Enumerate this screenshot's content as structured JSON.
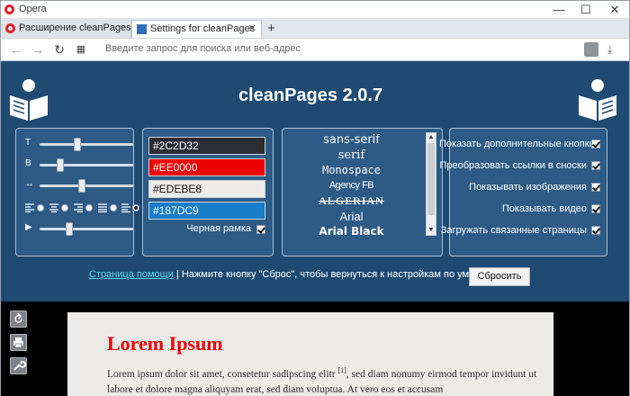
{
  "browser": {
    "app_name": "Opera",
    "tabs": [
      {
        "label": "Расширение cleanPages"
      },
      {
        "label": "Settings for cleanPages"
      }
    ],
    "address_placeholder": "Введите запрос для поиска или веб-адрес"
  },
  "settings": {
    "title": "cleanPages 2.0.7",
    "sliders": [
      {
        "name": "font-size",
        "level": 0.4
      },
      {
        "name": "line-height",
        "level": 0.2
      },
      {
        "name": "margins",
        "level": 0.45
      },
      {
        "name": "speed",
        "level": 0.3
      }
    ],
    "alignment_selected": 4,
    "colors": [
      {
        "value": "#2C2D32",
        "bg": "#2C2D32",
        "fg": "#ffffff"
      },
      {
        "value": "#EE0000",
        "bg": "#EE0000",
        "fg": "#ffffff"
      },
      {
        "value": "#EDEBE8",
        "bg": "#EDEBE8",
        "fg": "#111111"
      },
      {
        "value": "#187DC9",
        "bg": "#187DC9",
        "fg": "#ffffff"
      }
    ],
    "black_frame_label": "Черная рамка",
    "fonts": [
      "sans-serif",
      "serif",
      "Monospace",
      "Agency FB",
      "ALGERIAN",
      "Arial",
      "Arial Black"
    ],
    "options": [
      {
        "label": "Показать дополнительные кнопки",
        "checked": true
      },
      {
        "label": "Преобразовать ссылки в сноски",
        "checked": true
      },
      {
        "label": "Показывать изображения",
        "checked": true
      },
      {
        "label": "Показывать видео",
        "checked": true
      },
      {
        "label": "Загружать связанные страницы",
        "checked": true
      }
    ],
    "help_link": "Страница помощи",
    "help_text": " | Нажмите кнопку \"Сброс\", чтобы вернуться к настройкам по умолчанию.",
    "reset_label": "Сбросить"
  },
  "preview": {
    "heading": "Lorem Ipsum",
    "para_before": "Lorem ipsum dolor sit amet, consetetur sadipscing elitr ",
    "footnote": "[1]",
    "para_after": ", sed diam nonumy eirmod tempor invidunt ut labore et dolore magna aliquyam erat, sed diam voluptua. At vero eos et accusam"
  },
  "colors": {
    "settings_bg": "#1f4b73",
    "panel_bg": "#2d5b85",
    "heading_red": "#ee0000",
    "link_cyan": "#5cd4f0"
  }
}
